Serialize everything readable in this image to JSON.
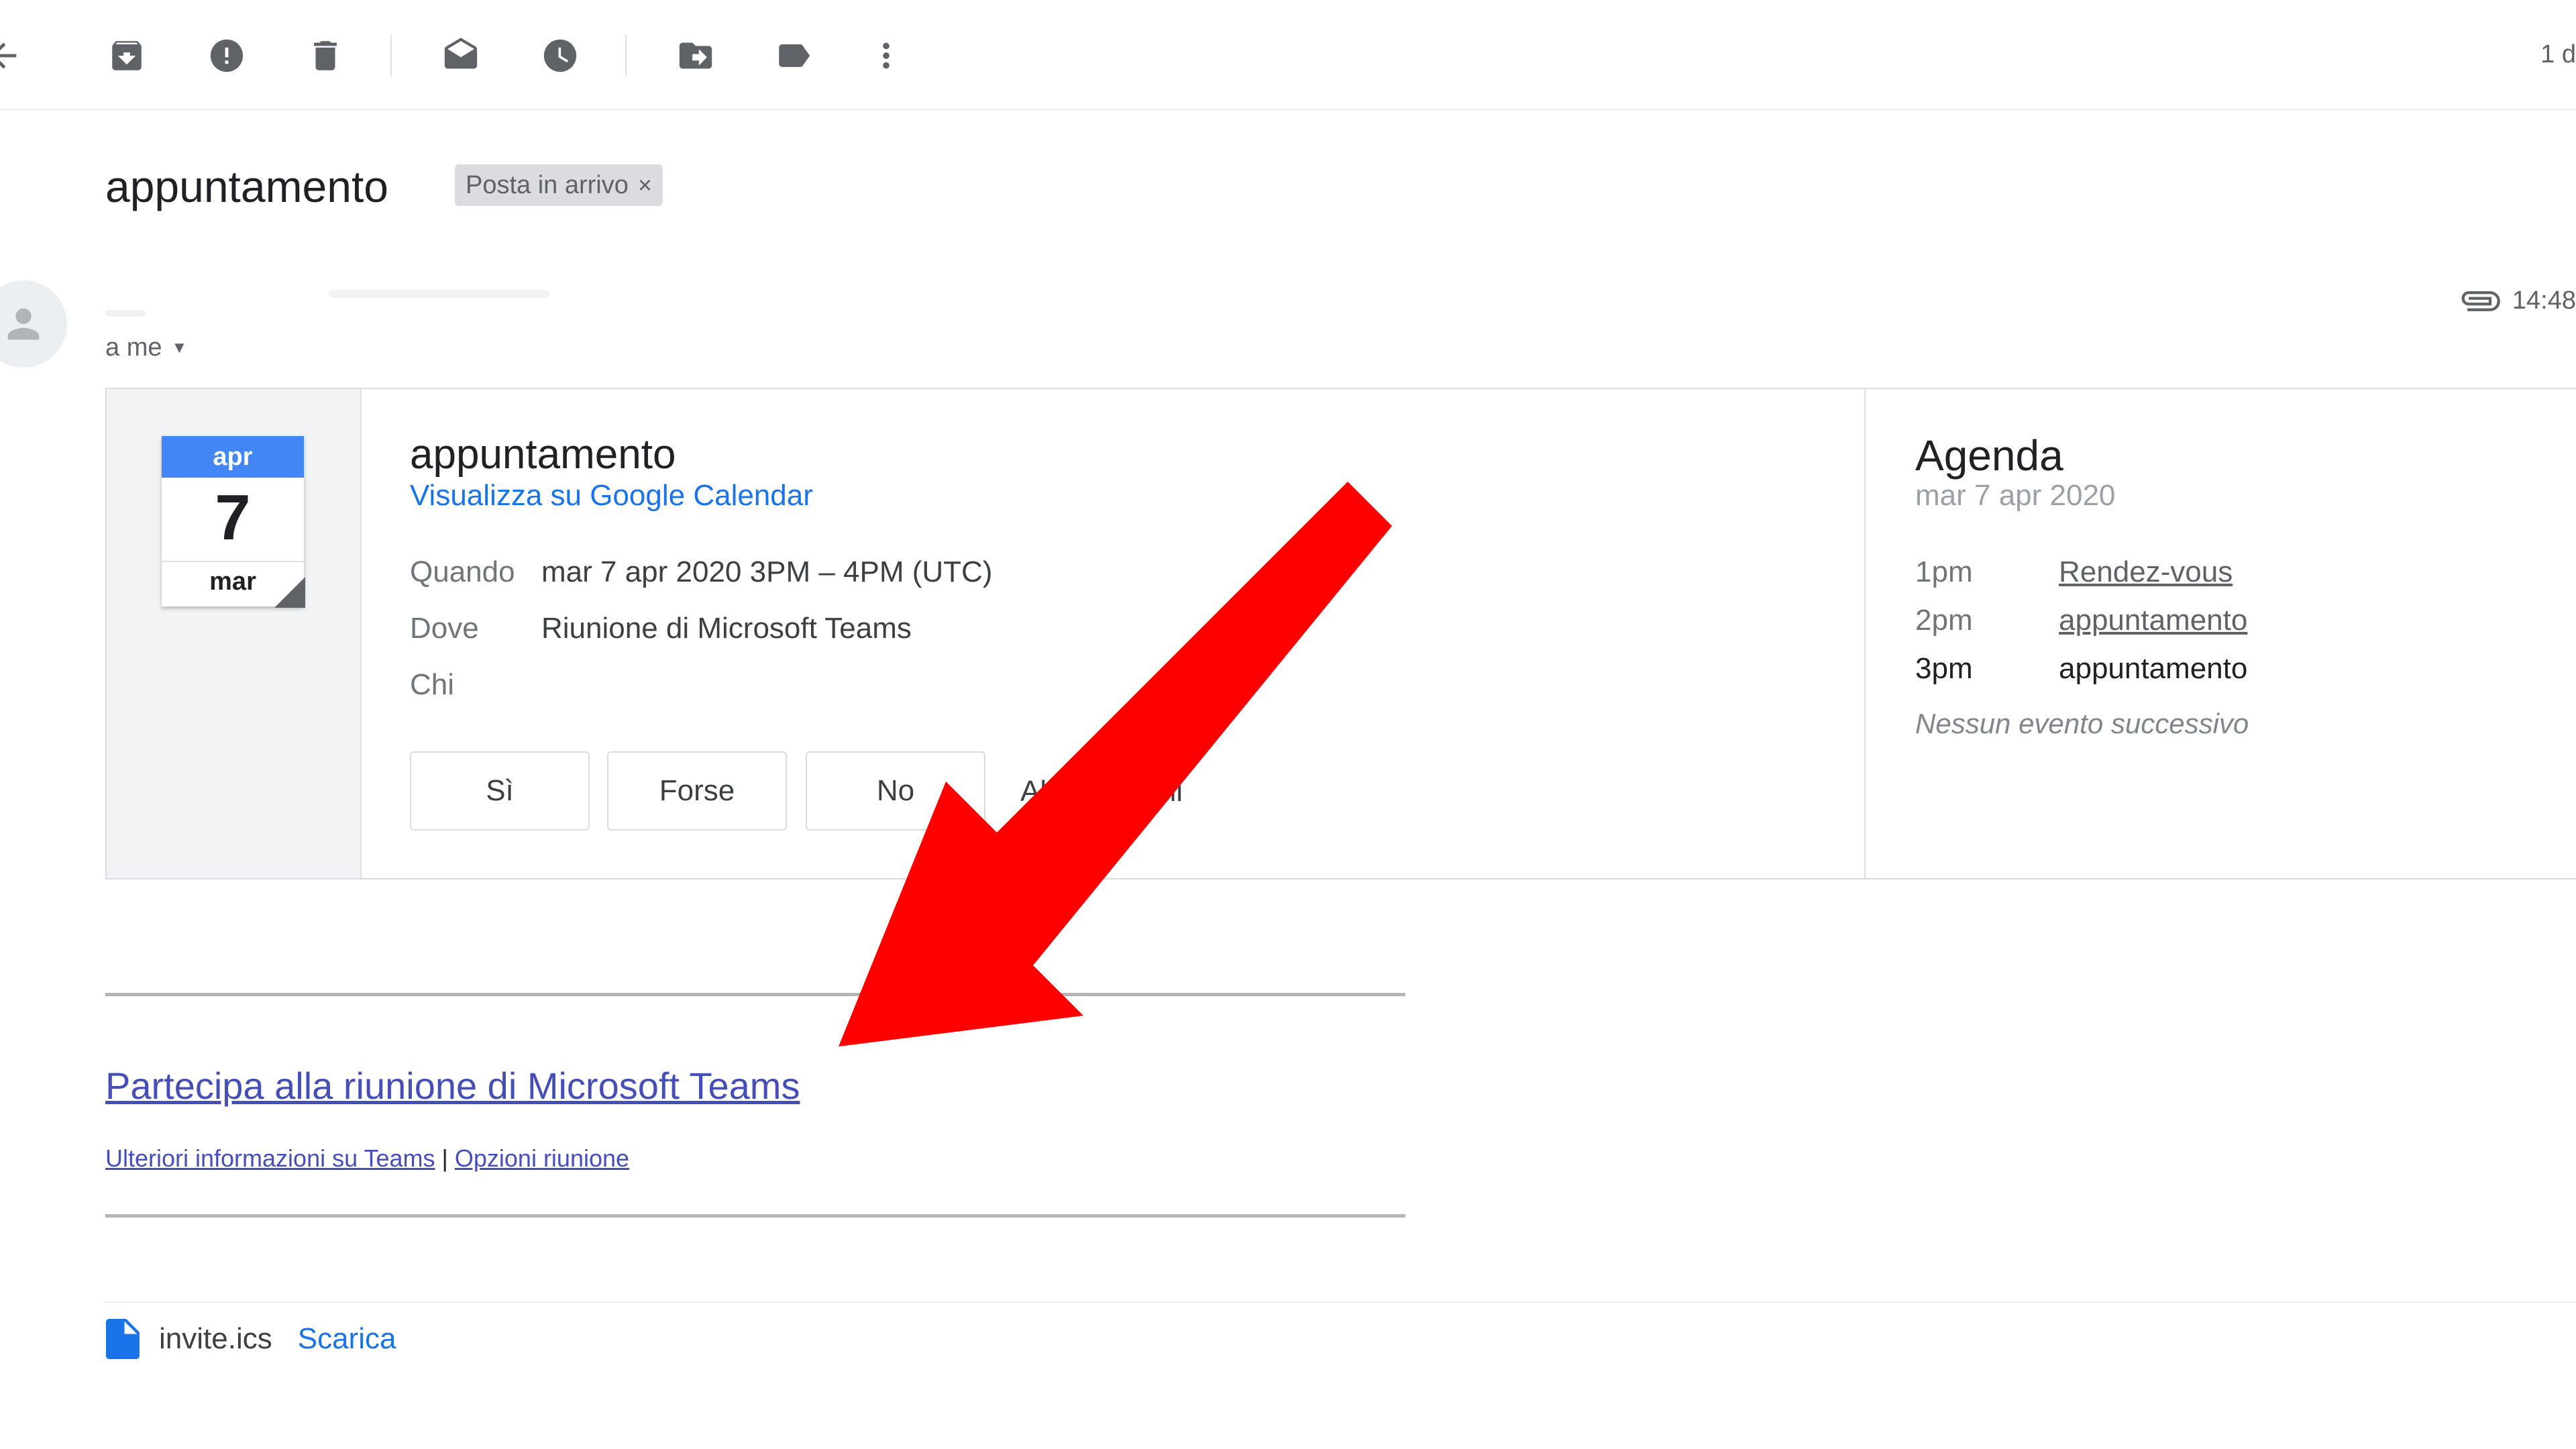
{
  "toolbar": {
    "icons": [
      "back-arrow-icon",
      "archive-icon",
      "report-spam-icon",
      "delete-icon",
      "mark-unread-icon",
      "snooze-icon",
      "move-to-icon",
      "label-icon",
      "more-vert-icon"
    ],
    "pager": "1 d"
  },
  "email": {
    "subject": "appuntamento",
    "label": "Posta in arrivo",
    "label_close": "×",
    "recipient": "a me",
    "time": "14:48"
  },
  "invite": {
    "calendar": {
      "month": "apr",
      "day": "7",
      "weekday": "mar"
    },
    "title": "appuntamento",
    "view_link": "Visualizza su Google Calendar",
    "when_label": "Quando",
    "when_value": "mar 7 apr 2020 3PM – 4PM (UTC)",
    "where_label": "Dove",
    "where_value": "Riunione di Microsoft Teams",
    "who_label": "Chi",
    "rsvp": {
      "yes": "Sì",
      "maybe": "Forse",
      "no": "No"
    },
    "other_options": "Altre opzioni"
  },
  "agenda": {
    "title": "Agenda",
    "date": "mar 7 apr 2020",
    "items": [
      {
        "time": "1pm",
        "name": "Rendez-vous"
      },
      {
        "time": "2pm",
        "name": "appuntamento"
      },
      {
        "time": "3pm",
        "name": "appuntamento"
      }
    ],
    "none": "Nessun evento successivo"
  },
  "teams": {
    "join": "Partecipa alla riunione di Microsoft Teams",
    "learn_more": "Ulteriori informazioni su Teams",
    "separator": "|",
    "options": "Opzioni riunione"
  },
  "attachment": {
    "filename": "invite.ics",
    "download": "Scarica"
  },
  "colors": {
    "arrow": "#ff0000",
    "link": "#1a73e8",
    "teams_link": "#464eb8",
    "calendar_header": "#4285f4"
  }
}
